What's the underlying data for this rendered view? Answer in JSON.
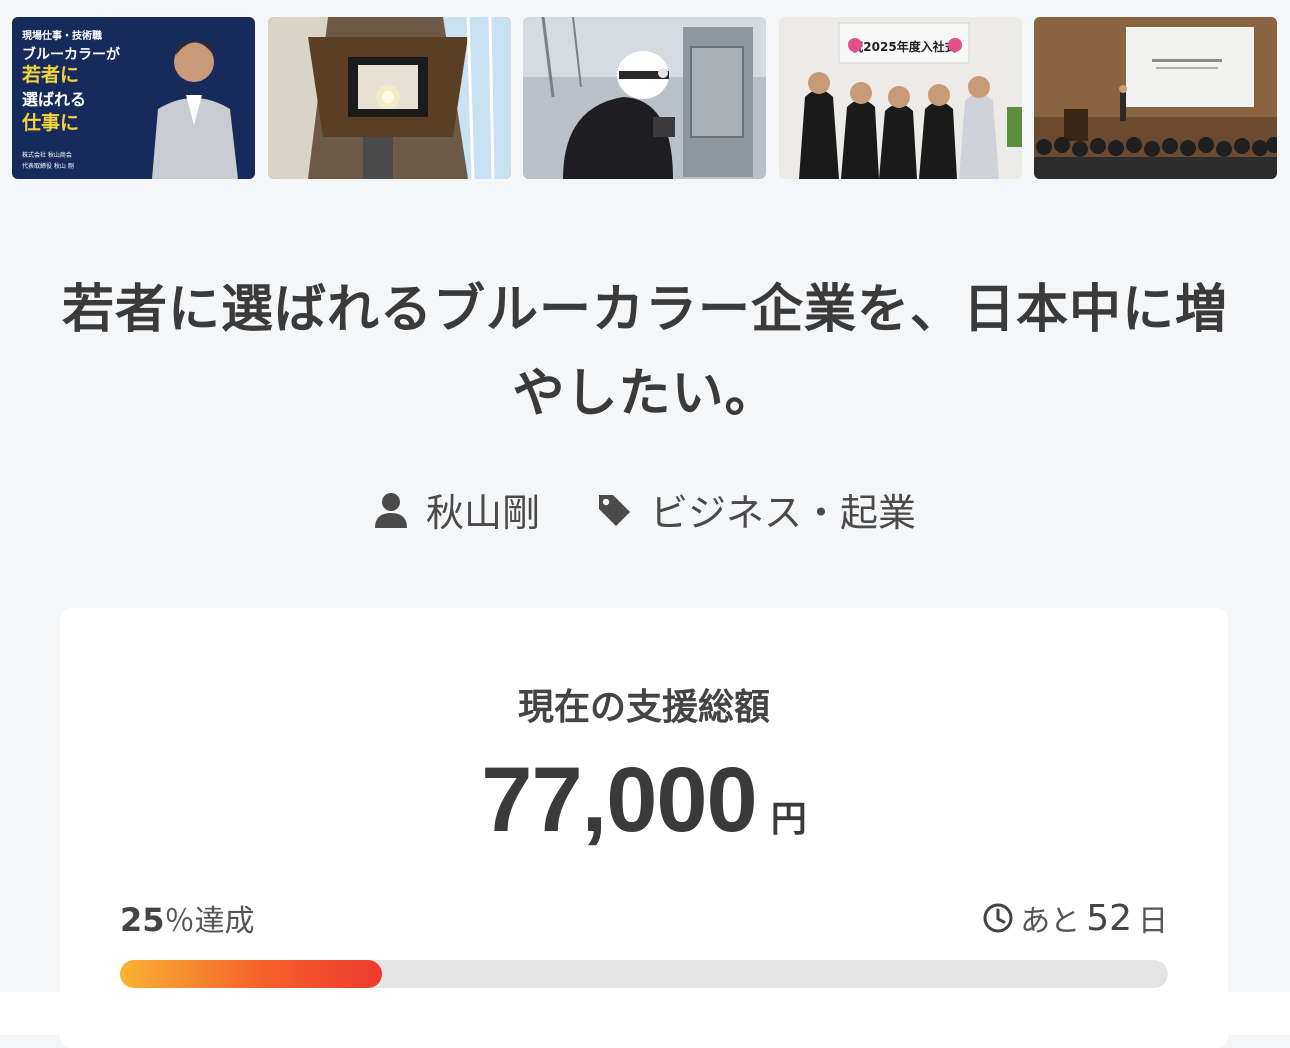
{
  "gallery": {
    "items": [
      {
        "name": "thumb-poster",
        "lines": [
          "現場仕事・技術職",
          "ブルーカラーが",
          "若者に",
          "選ばれる",
          "仕事に"
        ],
        "caption_top": "株式会社 秋山商会",
        "caption_bottom": "代表取締役 秋山 剛"
      },
      {
        "name": "thumb-interior"
      },
      {
        "name": "thumb-worker"
      },
      {
        "name": "thumb-ceremony",
        "banner": "祝2025年度入社式"
      },
      {
        "name": "thumb-seminar"
      }
    ]
  },
  "project": {
    "title": "若者に選ばれるブルーカラー企業を、日本中に増やしたい。",
    "owner": "秋山剛",
    "category": "ビジネス・起業"
  },
  "funding": {
    "label": "現在の支援総額",
    "amount": "77,000",
    "unit": "円",
    "percent": "25",
    "percent_suffix": "％達成",
    "progress": 0.25,
    "remaining_prefix": "あと",
    "remaining_days": "52",
    "remaining_suffix": "日"
  },
  "colors": {
    "accent_start": "#f9b233",
    "accent_end": "#ee3a2f",
    "poster_bg": "#1d3566",
    "poster_yellow": "#f2d43c"
  }
}
